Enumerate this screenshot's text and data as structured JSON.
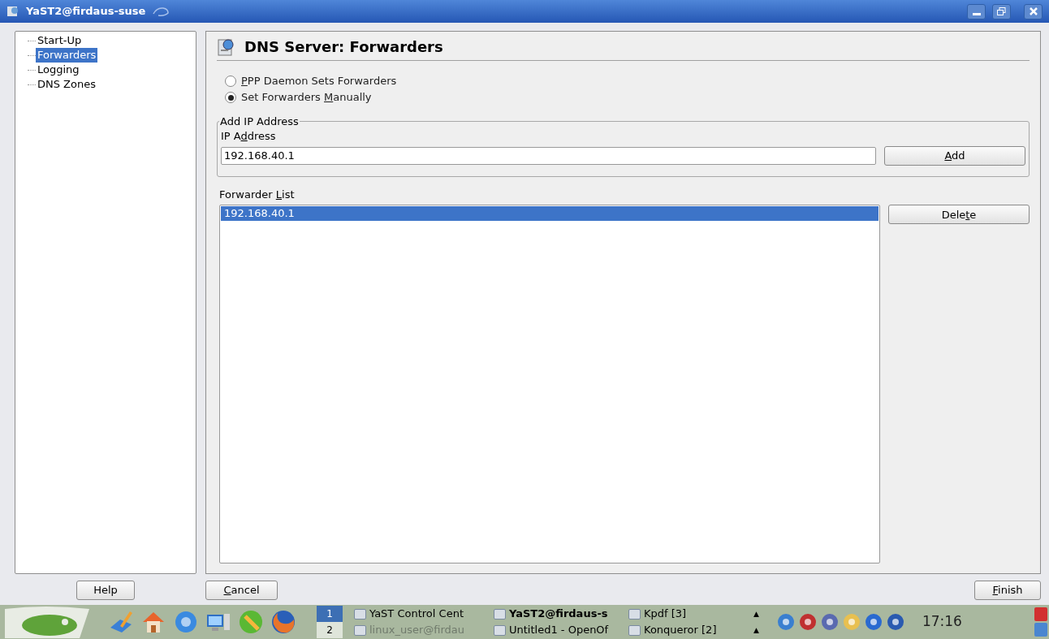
{
  "window": {
    "title": "YaST2@firdaus-suse"
  },
  "sidebar": {
    "items": [
      {
        "label": "Start-Up",
        "selected": false
      },
      {
        "label": "Forwarders",
        "selected": true
      },
      {
        "label": "Logging",
        "selected": false
      },
      {
        "label": "DNS Zones",
        "selected": false
      }
    ]
  },
  "header": {
    "title": "DNS Server: Forwarders"
  },
  "radios": [
    {
      "label": {
        "mnemonic": "P",
        "after": "PP Daemon Sets Forwarders"
      },
      "selected": false
    },
    {
      "label": {
        "before": "Set Forwarders ",
        "mnemonic": "M",
        "after": "anually"
      },
      "selected": true
    }
  ],
  "add_group": {
    "legend": "Add IP Address",
    "field_label": {
      "before": "IP A",
      "mnemonic": "d",
      "after": "dress"
    },
    "value": "192.168.40.1",
    "button": {
      "label": {
        "mnemonic": "A",
        "after": "dd"
      }
    }
  },
  "forwarder_list": {
    "label": {
      "before": "Forwarder ",
      "mnemonic": "L",
      "after": "ist"
    },
    "rows": [
      {
        "text": "192.168.40.1",
        "selected": true
      }
    ],
    "button": {
      "label": {
        "before": "Dele",
        "mnemonic": "t",
        "after": "e"
      }
    }
  },
  "bottom_buttons": {
    "help": {
      "label": {
        "before": "Help"
      }
    },
    "cancel": {
      "label": {
        "mnemonic": "C",
        "after": "ancel"
      }
    },
    "finish": {
      "label": {
        "mnemonic": "F",
        "after": "inish"
      }
    }
  },
  "expand_arrows": [
    "▲",
    "▲"
  ],
  "taskbar": {
    "pager": [
      {
        "label": "1",
        "selected": true
      },
      {
        "label": "2",
        "selected": false
      }
    ],
    "tasks": [
      {
        "label": "YaST Control Cent",
        "selected": false,
        "minimized": false
      },
      {
        "label": "YaST2@firdaus-s",
        "selected": true,
        "minimized": false
      },
      {
        "label": "Kpdf [3]",
        "selected": false,
        "minimized": false
      },
      {
        "label": "linux_user@firdau",
        "selected": false,
        "minimized": true
      },
      {
        "label": "Untitled1 - OpenOf",
        "selected": false,
        "minimized": false
      },
      {
        "label": "Konqueror [2]",
        "selected": false,
        "minimized": false
      }
    ],
    "clock": "17:16"
  }
}
